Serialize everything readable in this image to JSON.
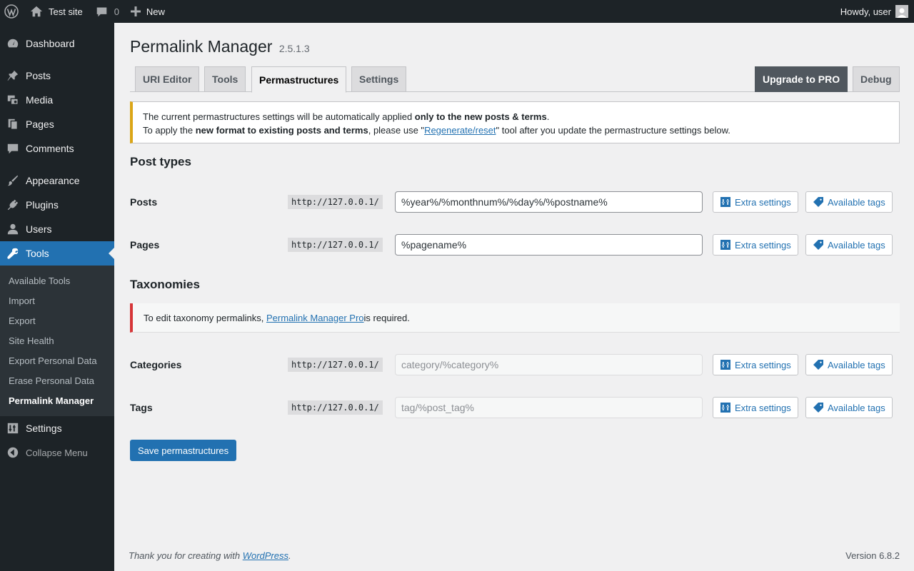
{
  "adminbar": {
    "site_name": "Test site",
    "comments_count": "0",
    "new_label": "New",
    "howdy": "Howdy, user"
  },
  "sidebar": {
    "items": [
      {
        "label": "Dashboard",
        "icon": "dashboard-icon"
      },
      {
        "label": "Posts",
        "icon": "pin-icon"
      },
      {
        "label": "Media",
        "icon": "media-icon"
      },
      {
        "label": "Pages",
        "icon": "pages-icon"
      },
      {
        "label": "Comments",
        "icon": "comment-icon"
      },
      {
        "label": "Appearance",
        "icon": "brush-icon"
      },
      {
        "label": "Plugins",
        "icon": "plug-icon"
      },
      {
        "label": "Users",
        "icon": "user-icon"
      },
      {
        "label": "Tools",
        "icon": "wrench-icon"
      },
      {
        "label": "Settings",
        "icon": "sliders-icon"
      }
    ],
    "tools_submenu": [
      "Available Tools",
      "Import",
      "Export",
      "Site Health",
      "Export Personal Data",
      "Erase Personal Data",
      "Permalink Manager"
    ],
    "collapse_label": "Collapse Menu"
  },
  "page": {
    "title": "Permalink Manager",
    "version": "2.5.1.3"
  },
  "tabs": {
    "uri_editor": "URI Editor",
    "tools": "Tools",
    "permastructures": "Permastructures",
    "settings": "Settings",
    "upgrade": "Upgrade to PRO",
    "debug": "Debug"
  },
  "notice": {
    "line1_pre": "The current permastructures settings will be automatically applied ",
    "line1_bold": "only to the new posts & terms",
    "line1_post": ".",
    "line2_pre": "To apply the ",
    "line2_bold": "new format to existing posts and terms",
    "line2_mid": ", please use \"",
    "line2_link": "Regenerate/reset",
    "line2_post": "\" tool after you update the permastructure settings below."
  },
  "post_types": {
    "title": "Post types",
    "rows": [
      {
        "label": "Posts",
        "prefix": "http://127.0.0.1/",
        "value": "%year%/%monthnum%/%day%/%postname%"
      },
      {
        "label": "Pages",
        "prefix": "http://127.0.0.1/",
        "value": "%pagename%"
      }
    ]
  },
  "taxonomies": {
    "title": "Taxonomies",
    "notice_pre": "To edit taxonomy permalinks, ",
    "notice_link": "Permalink Manager Pro",
    "notice_post": " is required.",
    "rows": [
      {
        "label": "Categories",
        "prefix": "http://127.0.0.1/",
        "value": "category/%category%"
      },
      {
        "label": "Tags",
        "prefix": "http://127.0.0.1/",
        "value": "tag/%post_tag%"
      }
    ]
  },
  "buttons": {
    "extra_settings": "Extra settings",
    "available_tags": "Available tags",
    "save": "Save permastructures"
  },
  "footer": {
    "thanks_pre": "Thank you for creating with ",
    "thanks_link": "WordPress",
    "thanks_post": ".",
    "version": "Version 6.8.2"
  }
}
